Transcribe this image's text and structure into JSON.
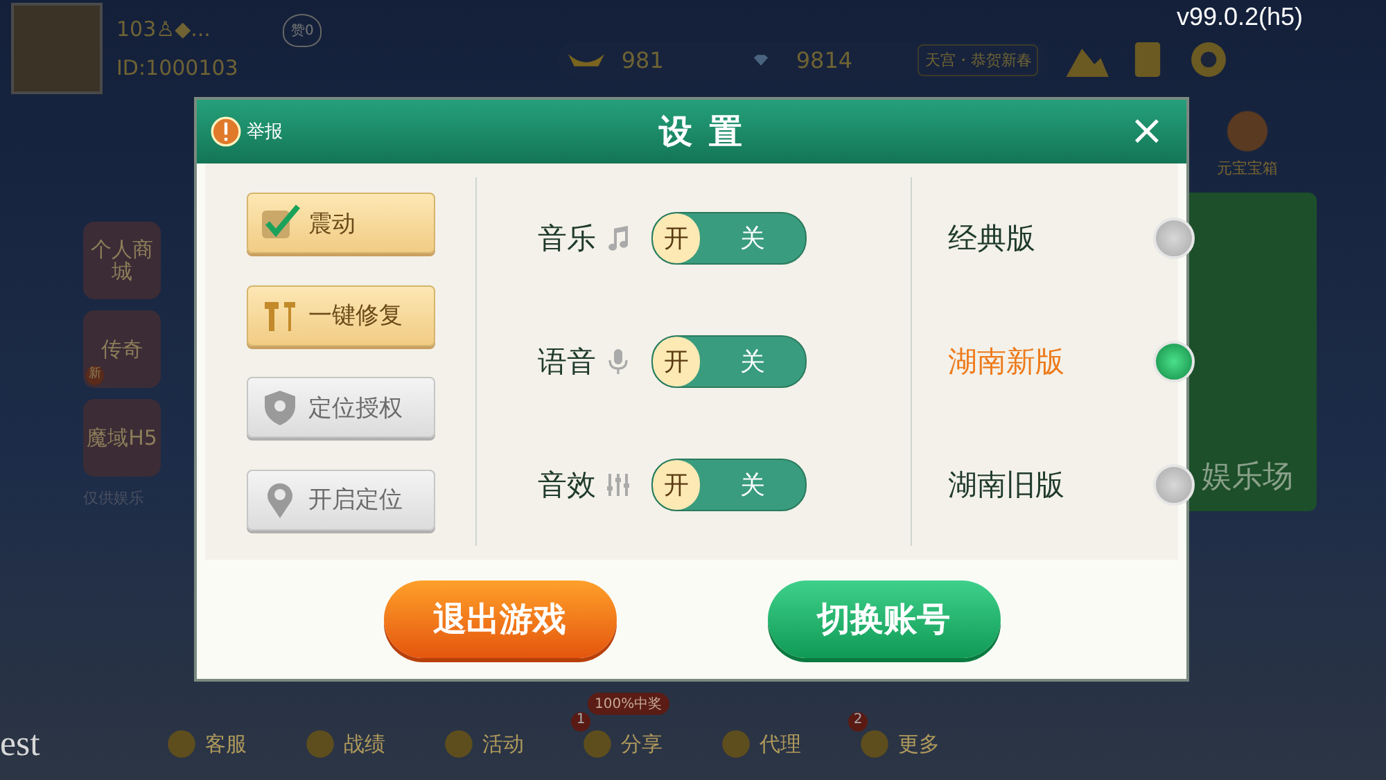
{
  "top_bar": {
    "name": "103♙◆...",
    "user_id": "ID:1000103",
    "likes": "赞0",
    "gold": "981",
    "diamonds": "9814",
    "notice": "天宫・恭贺新春",
    "version": "v99.0.2(h5)"
  },
  "treasure": {
    "label": "元宝宝箱"
  },
  "games": [
    {
      "label": "个人商城"
    },
    {
      "label": "传奇",
      "badge": "新"
    },
    {
      "label": "魔域H5"
    }
  ],
  "games_note": "仅供娱乐",
  "hall_card": {
    "label": "娱乐场"
  },
  "corner_text": "est",
  "bottom_nav": [
    {
      "label": "客服"
    },
    {
      "label": "战绩"
    },
    {
      "label": "活动"
    },
    {
      "label": "分享",
      "badge": "1",
      "tag": "100%中奖"
    },
    {
      "label": "代理"
    },
    {
      "label": "更多",
      "badge": "2"
    }
  ],
  "dialog": {
    "title": "设 置",
    "report": "举报",
    "close": "×",
    "left_buttons": [
      {
        "label": "震动",
        "kind": "check",
        "checked": true,
        "disabled": false
      },
      {
        "label": "一键修复",
        "kind": "repair",
        "disabled": false
      },
      {
        "label": "定位授权",
        "kind": "shield",
        "disabled": true
      },
      {
        "label": "开启定位",
        "kind": "pin",
        "disabled": true
      }
    ],
    "toggles": [
      {
        "label": "音乐",
        "kind": "music",
        "on_text": "开",
        "off_text": "关",
        "on": true
      },
      {
        "label": "语音",
        "kind": "mic",
        "on_text": "开",
        "off_text": "关",
        "on": true
      },
      {
        "label": "音效",
        "kind": "eq",
        "on_text": "开",
        "off_text": "关",
        "on": true
      }
    ],
    "versions": [
      {
        "label": "经典版",
        "selected": false
      },
      {
        "label": "湖南新版",
        "selected": true
      },
      {
        "label": "湖南旧版",
        "selected": false
      }
    ],
    "actions": [
      {
        "label": "退出游戏",
        "kind": "danger"
      },
      {
        "label": "切换账号",
        "kind": "primary"
      }
    ]
  }
}
